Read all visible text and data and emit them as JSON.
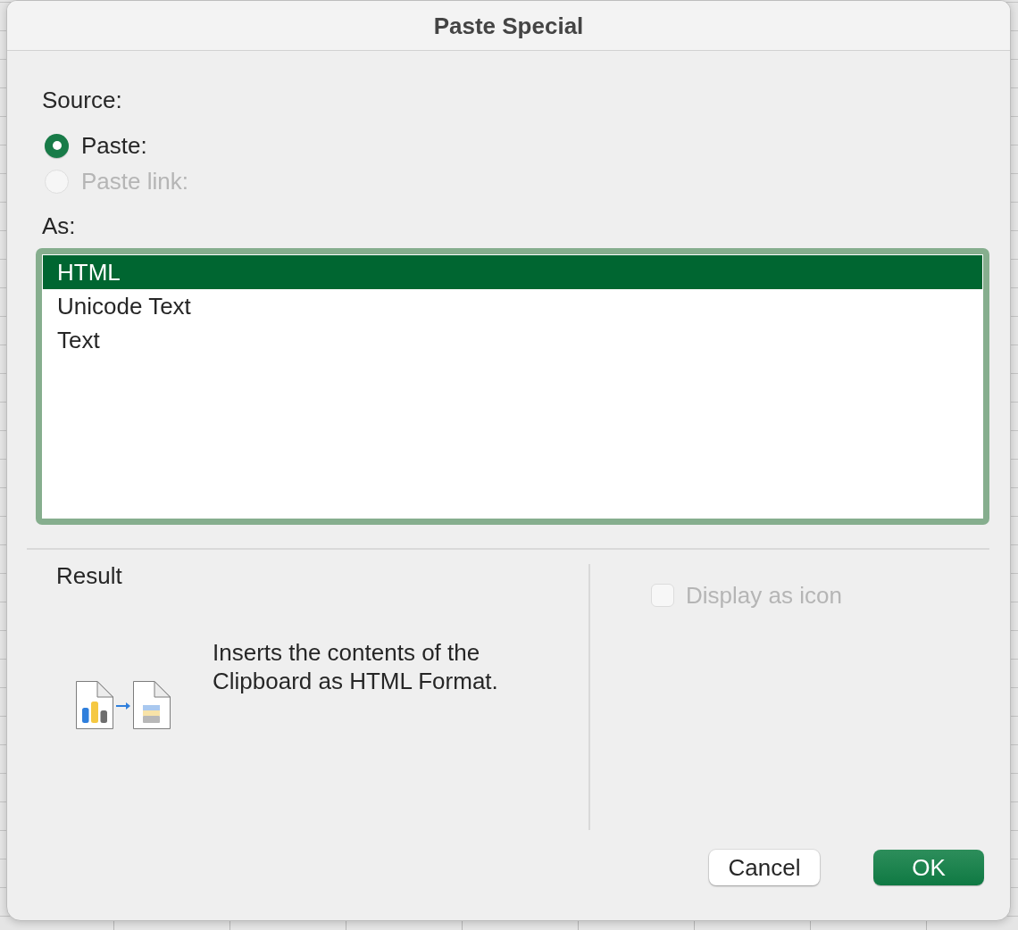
{
  "window": {
    "title": "Paste Special"
  },
  "source": {
    "label": "Source:",
    "options": [
      {
        "label": "Paste:",
        "selected": true,
        "disabled": false
      },
      {
        "label": "Paste link:",
        "selected": false,
        "disabled": true
      }
    ]
  },
  "as": {
    "label": "As:",
    "items": [
      {
        "label": "HTML",
        "selected": true
      },
      {
        "label": "Unicode Text",
        "selected": false
      },
      {
        "label": "Text",
        "selected": false
      }
    ]
  },
  "result": {
    "label": "Result",
    "description": "Inserts the contents of the Clipboard as HTML Format."
  },
  "display_as_icon": {
    "label": "Display as icon",
    "checked": false,
    "disabled": true
  },
  "buttons": [
    {
      "label": "Cancel",
      "kind": "secondary"
    },
    {
      "label": "OK",
      "kind": "primary"
    }
  ]
}
